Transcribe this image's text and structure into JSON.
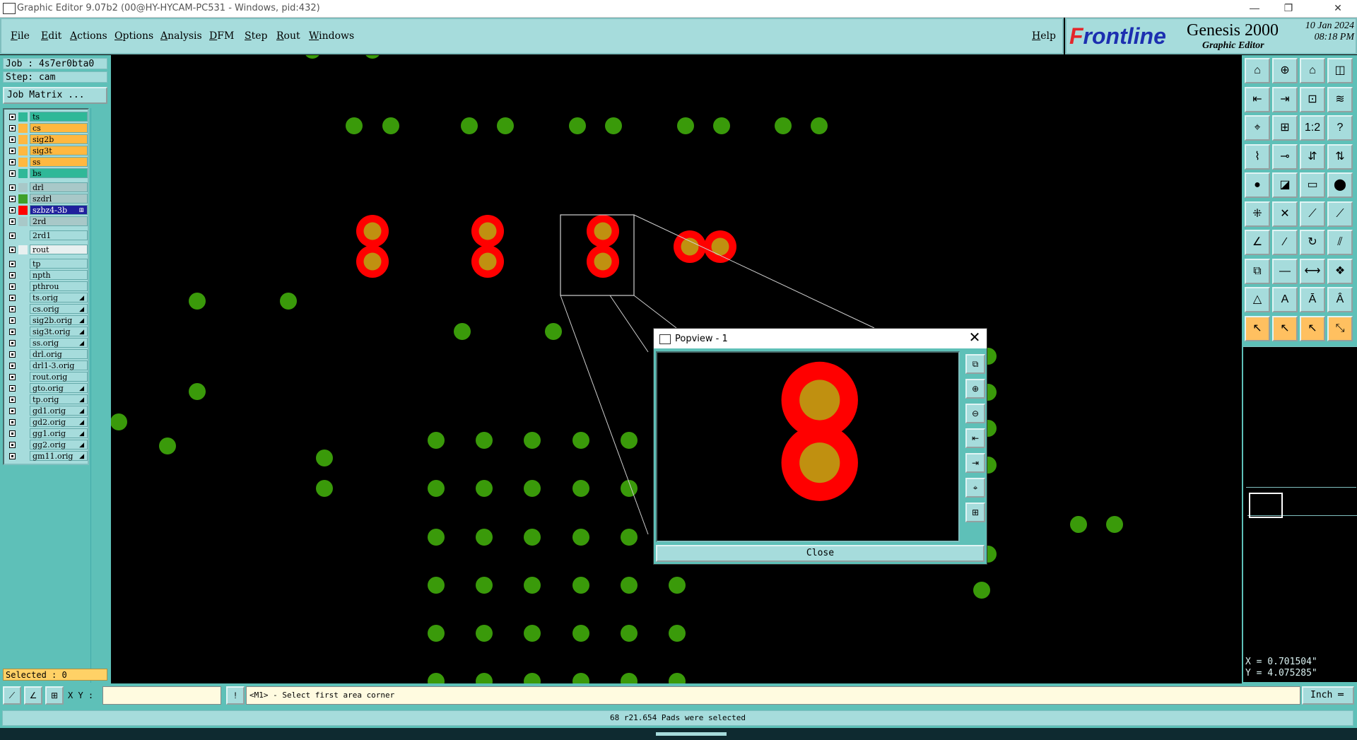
{
  "window": {
    "title": "Graphic Editor 9.07b2 (00@HY-HYCAM-PC531 - Windows, pid:432)",
    "minimize": "—",
    "restore": "❐",
    "close": "✕"
  },
  "menu": [
    "File",
    "Edit",
    "Actions",
    "Options",
    "Analysis",
    "DFM",
    "Step",
    "Rout",
    "Windows"
  ],
  "help": "Help",
  "brand": {
    "logo_prefix": "F",
    "logo_rest": "rontline",
    "product": "Genesis 2000",
    "subtitle": "Graphic Editor",
    "date": "10 Jan 2024",
    "time": "08:18 PM"
  },
  "job": {
    "job_line": "Job : 4s7er0bta0",
    "step_line": "Step: cam",
    "matrix_button": "Job Matrix ..."
  },
  "layers": [
    {
      "name": "ts",
      "bg": "#2fb898",
      "swatch": "#2fb898"
    },
    {
      "name": "cs",
      "bg": "#ffb840",
      "swatch": "#ffb840"
    },
    {
      "name": "sig2b",
      "bg": "#ffb840",
      "swatch": "#ffb840"
    },
    {
      "name": "sig3t",
      "bg": "#ffb840",
      "swatch": "#ffb840"
    },
    {
      "name": "ss",
      "bg": "#ffb840",
      "swatch": "#ffb840"
    },
    {
      "name": "bs",
      "bg": "#2fb898",
      "swatch": "#2fb898"
    },
    {
      "name": "drl",
      "bg": "#a8c8c8",
      "swatch": "#a8c8c8",
      "gap": true
    },
    {
      "name": "szdrl",
      "bg": "#a8c8c8",
      "swatch": "#3fa02a"
    },
    {
      "name": "szbz4-3b",
      "bg": "#1f1f9c",
      "swatch": "#ff0000",
      "fg": "#ffffff",
      "mark": "⊞"
    },
    {
      "name": "2rd",
      "bg": "#a8c8c8",
      "swatch": "#a8c8c8"
    },
    {
      "name": "2rd1",
      "bg": "#a6dcdc",
      "swatch": "#a6dcdc",
      "gap": true
    },
    {
      "name": "rout",
      "bg": "#e8f0f0",
      "swatch": "#e8f0f0",
      "gap": true
    },
    {
      "name": "tp",
      "bg": "#a6dcdc",
      "swatch": "#a6dcdc",
      "gap": true
    },
    {
      "name": "npth",
      "bg": "#a6dcdc",
      "swatch": "#a6dcdc"
    },
    {
      "name": "pthrou",
      "bg": "#a6dcdc",
      "swatch": "#a6dcdc"
    },
    {
      "name": "ts.orig",
      "bg": "#a6dcdc",
      "swatch": "#a6dcdc",
      "mark": "◢"
    },
    {
      "name": "cs.orig",
      "bg": "#a6dcdc",
      "swatch": "#a6dcdc",
      "mark": "◢"
    },
    {
      "name": "sig2b.orig",
      "bg": "#a6dcdc",
      "swatch": "#a6dcdc",
      "mark": "◢"
    },
    {
      "name": "sig3t.orig",
      "bg": "#a6dcdc",
      "swatch": "#a6dcdc",
      "mark": "◢"
    },
    {
      "name": "ss.orig",
      "bg": "#a6dcdc",
      "swatch": "#a6dcdc",
      "mark": "◢"
    },
    {
      "name": "drl.orig",
      "bg": "#a6dcdc",
      "swatch": "#a6dcdc"
    },
    {
      "name": "drl1-3.orig",
      "bg": "#a6dcdc",
      "swatch": "#a6dcdc"
    },
    {
      "name": "rout.orig",
      "bg": "#a6dcdc",
      "swatch": "#a6dcdc"
    },
    {
      "name": "gto.orig",
      "bg": "#a6dcdc",
      "swatch": "#a6dcdc",
      "mark": "◢"
    },
    {
      "name": "tp.orig",
      "bg": "#a6dcdc",
      "swatch": "#a6dcdc",
      "mark": "◢"
    },
    {
      "name": "gd1.orig",
      "bg": "#a6dcdc",
      "swatch": "#a6dcdc",
      "mark": "◢"
    },
    {
      "name": "gd2.orig",
      "bg": "#a6dcdc",
      "swatch": "#a6dcdc",
      "mark": "◢"
    },
    {
      "name": "gg1.orig",
      "bg": "#a6dcdc",
      "swatch": "#a6dcdc",
      "mark": "◢"
    },
    {
      "name": "gg2.orig",
      "bg": "#a6dcdc",
      "swatch": "#a6dcdc",
      "mark": "◢"
    },
    {
      "name": "gm11.orig",
      "bg": "#a6dcdc",
      "swatch": "#a6dcdc",
      "mark": "◢"
    }
  ],
  "selected": "Selected : 0",
  "coords": {
    "x": "X = 0.701504\"",
    "y": "Y = 4.075285\""
  },
  "bottom": {
    "xy_label": "X Y :",
    "xy_value": "",
    "prompt": "<M1> - Select first area corner",
    "unit": "Inch ═"
  },
  "status": "68 r21.654 Pads were selected",
  "popview": {
    "title": "Popview - 1",
    "close_button": "Close",
    "close_icon": "✕"
  },
  "colors": {
    "pad_green": "#3a9a0a",
    "pad_red": "#ff0000",
    "pad_gold": "#c09010",
    "panel": "#5ec0b8",
    "widget": "#a6dcdc"
  },
  "icons": {
    "tools": [
      {
        "name": "zoom-home-icon",
        "glyph": "⌂"
      },
      {
        "name": "zoom-in-icon",
        "glyph": "⊕"
      },
      {
        "name": "zoom-home2-icon",
        "glyph": "⌂"
      },
      {
        "name": "window-split-icon",
        "glyph": "◫"
      },
      {
        "name": "pan-left-icon",
        "glyph": "⇤"
      },
      {
        "name": "pan-right-icon",
        "glyph": "⇥"
      },
      {
        "name": "fit-screen-icon",
        "glyph": "⊡"
      },
      {
        "name": "redraw-icon",
        "glyph": "≋"
      },
      {
        "name": "zoom-fit-icon",
        "glyph": "⌖"
      },
      {
        "name": "zoom-center-icon",
        "glyph": "⊞"
      },
      {
        "name": "ratio-icon",
        "glyph": "1:2"
      },
      {
        "name": "help-icon",
        "glyph": "?"
      },
      {
        "name": "snap-icon",
        "glyph": "⌇"
      },
      {
        "name": "measure-icon",
        "glyph": "⊸"
      },
      {
        "name": "layer-up-icon",
        "glyph": "⇵"
      },
      {
        "name": "layer-down-icon",
        "glyph": "⇅"
      },
      {
        "name": "pad-add-icon",
        "glyph": "●"
      },
      {
        "name": "shape-icon",
        "glyph": "◪"
      },
      {
        "name": "ruler-icon",
        "glyph": "▭"
      },
      {
        "name": "dot-icon",
        "glyph": "⬤"
      },
      {
        "name": "connect-icon",
        "glyph": "⁜"
      },
      {
        "name": "intersect-icon",
        "glyph": "✕"
      },
      {
        "name": "line-node-icon",
        "glyph": "⟋"
      },
      {
        "name": "line-node2-icon",
        "glyph": "⟋"
      },
      {
        "name": "draw-line-icon",
        "glyph": "∠"
      },
      {
        "name": "draw-slant-icon",
        "glyph": "⁄"
      },
      {
        "name": "rotate-icon",
        "glyph": "↻"
      },
      {
        "name": "mirror-icon",
        "glyph": "⫽"
      },
      {
        "name": "move-pad-icon",
        "glyph": "⧉"
      },
      {
        "name": "line-dash-icon",
        "glyph": "—"
      },
      {
        "name": "stretch-icon",
        "glyph": "⟷"
      },
      {
        "name": "copy-pad-icon",
        "glyph": "❖"
      },
      {
        "name": "triangle-icon",
        "glyph": "△"
      },
      {
        "name": "arrow-a-icon",
        "glyph": "A"
      },
      {
        "name": "arrow-b-icon",
        "glyph": "Ā"
      },
      {
        "name": "arrow-c-icon",
        "glyph": "Â"
      },
      {
        "name": "select-pointer-icon",
        "glyph": "↖",
        "orange": true
      },
      {
        "name": "select-box-icon",
        "glyph": "↖",
        "orange": true
      },
      {
        "name": "select-lasso-icon",
        "glyph": "↖",
        "orange": true
      },
      {
        "name": "select-path-icon",
        "glyph": "⤡",
        "orange": true
      }
    ],
    "popview_tools": [
      {
        "name": "popview-zoom-home-icon",
        "glyph": "⧉"
      },
      {
        "name": "popview-zoom-in-icon",
        "glyph": "⊕"
      },
      {
        "name": "popview-zoom-out-icon",
        "glyph": "⊖"
      },
      {
        "name": "popview-pan-left-icon",
        "glyph": "⇤"
      },
      {
        "name": "popview-pan-right-icon",
        "glyph": "⇥"
      },
      {
        "name": "popview-fit-icon",
        "glyph": "⌖"
      },
      {
        "name": "popview-center-icon",
        "glyph": "⊞"
      }
    ]
  }
}
